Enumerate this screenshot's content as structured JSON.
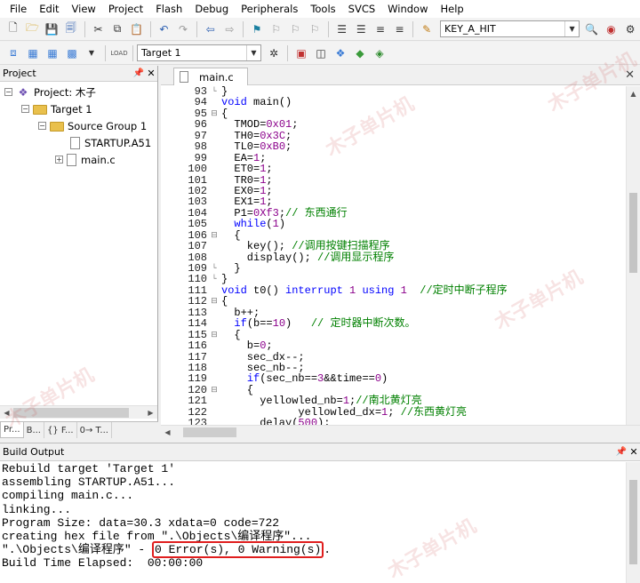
{
  "menu": [
    "File",
    "Edit",
    "View",
    "Project",
    "Flash",
    "Debug",
    "Peripherals",
    "Tools",
    "SVCS",
    "Window",
    "Help"
  ],
  "toolbar": {
    "search_combo": "KEY_A_HIT",
    "target_combo": "Target 1"
  },
  "project_panel": {
    "title": "Project",
    "root": "Project: 木子",
    "target": "Target 1",
    "group": "Source Group 1",
    "files": [
      "STARTUP.A51",
      "main.c"
    ],
    "tabs": [
      "Pr...",
      "B...",
      "{} F...",
      "0→ T..."
    ]
  },
  "editor": {
    "active_tab": "main.c",
    "lines": [
      {
        "n": "93",
        "fold": "└",
        "code": "}"
      },
      {
        "n": "94",
        "fold": "",
        "code": "void main()"
      },
      {
        "n": "95",
        "fold": "⊟",
        "code": "{"
      },
      {
        "n": "96",
        "fold": "",
        "code": "  TMOD=0x01;"
      },
      {
        "n": "97",
        "fold": "",
        "code": "  TH0=0x3C;"
      },
      {
        "n": "98",
        "fold": "",
        "code": "  TL0=0xB0;"
      },
      {
        "n": "99",
        "fold": "",
        "code": "  EA=1;"
      },
      {
        "n": "100",
        "fold": "",
        "code": "  ET0=1;"
      },
      {
        "n": "101",
        "fold": "",
        "code": "  TR0=1;"
      },
      {
        "n": "102",
        "fold": "",
        "code": "  EX0=1;"
      },
      {
        "n": "103",
        "fold": "",
        "code": "  EX1=1;"
      },
      {
        "n": "104",
        "fold": "",
        "code": "  P1=0Xf3;// 东西通行"
      },
      {
        "n": "105",
        "fold": "",
        "code": "  while(1)"
      },
      {
        "n": "106",
        "fold": "⊟",
        "code": "  {"
      },
      {
        "n": "107",
        "fold": "",
        "code": "    key(); //调用按键扫描程序"
      },
      {
        "n": "108",
        "fold": "",
        "code": "    display(); //调用显示程序"
      },
      {
        "n": "109",
        "fold": "└",
        "code": "  }"
      },
      {
        "n": "110",
        "fold": "└",
        "code": "}"
      },
      {
        "n": "111",
        "fold": "",
        "code": "void t0() interrupt 1 using 1  //定时中断子程序"
      },
      {
        "n": "112",
        "fold": "⊟",
        "code": "{"
      },
      {
        "n": "113",
        "fold": "",
        "code": "  b++;"
      },
      {
        "n": "114",
        "fold": "",
        "code": "  if(b==10)   // 定时器中断次数。"
      },
      {
        "n": "115",
        "fold": "⊟",
        "code": "  {"
      },
      {
        "n": "116",
        "fold": "",
        "code": "    b=0;"
      },
      {
        "n": "117",
        "fold": "",
        "code": "    sec_dx--;"
      },
      {
        "n": "118",
        "fold": "",
        "code": "    sec_nb--;"
      },
      {
        "n": "119",
        "fold": "",
        "code": "    if(sec_nb==3&&time==0)"
      },
      {
        "n": "120",
        "fold": "⊟",
        "code": "    {"
      },
      {
        "n": "121",
        "fold": "",
        "code": "      yellowled_nb=1;//南北黄灯亮"
      },
      {
        "n": "122",
        "fold": "",
        "code": "            yellowled_dx=1; //东西黄灯亮"
      },
      {
        "n": "123",
        "fold": "",
        "code": "      delay(500);"
      }
    ]
  },
  "build_output": {
    "title": "Build Output",
    "lines": [
      "Rebuild target 'Target 1'",
      "assembling STARTUP.A51...",
      "compiling main.c...",
      "linking...",
      "Program Size: data=30.3 xdata=0 code=722",
      "creating hex file from \".\\Objects\\编译程序\"..."
    ],
    "result_prefix": "\".\\Objects\\编译程序\" - ",
    "result_highlight": "0 Error(s), 0 Warning(s)",
    "result_suffix": ".",
    "elapsed": "Build Time Elapsed:  00:00:00"
  },
  "watermark": "木子单片机",
  "colors": {
    "keyword": "#0000ff",
    "number": "#8b008b",
    "comment": "#008000",
    "highlight_border": "#e01e1e"
  }
}
